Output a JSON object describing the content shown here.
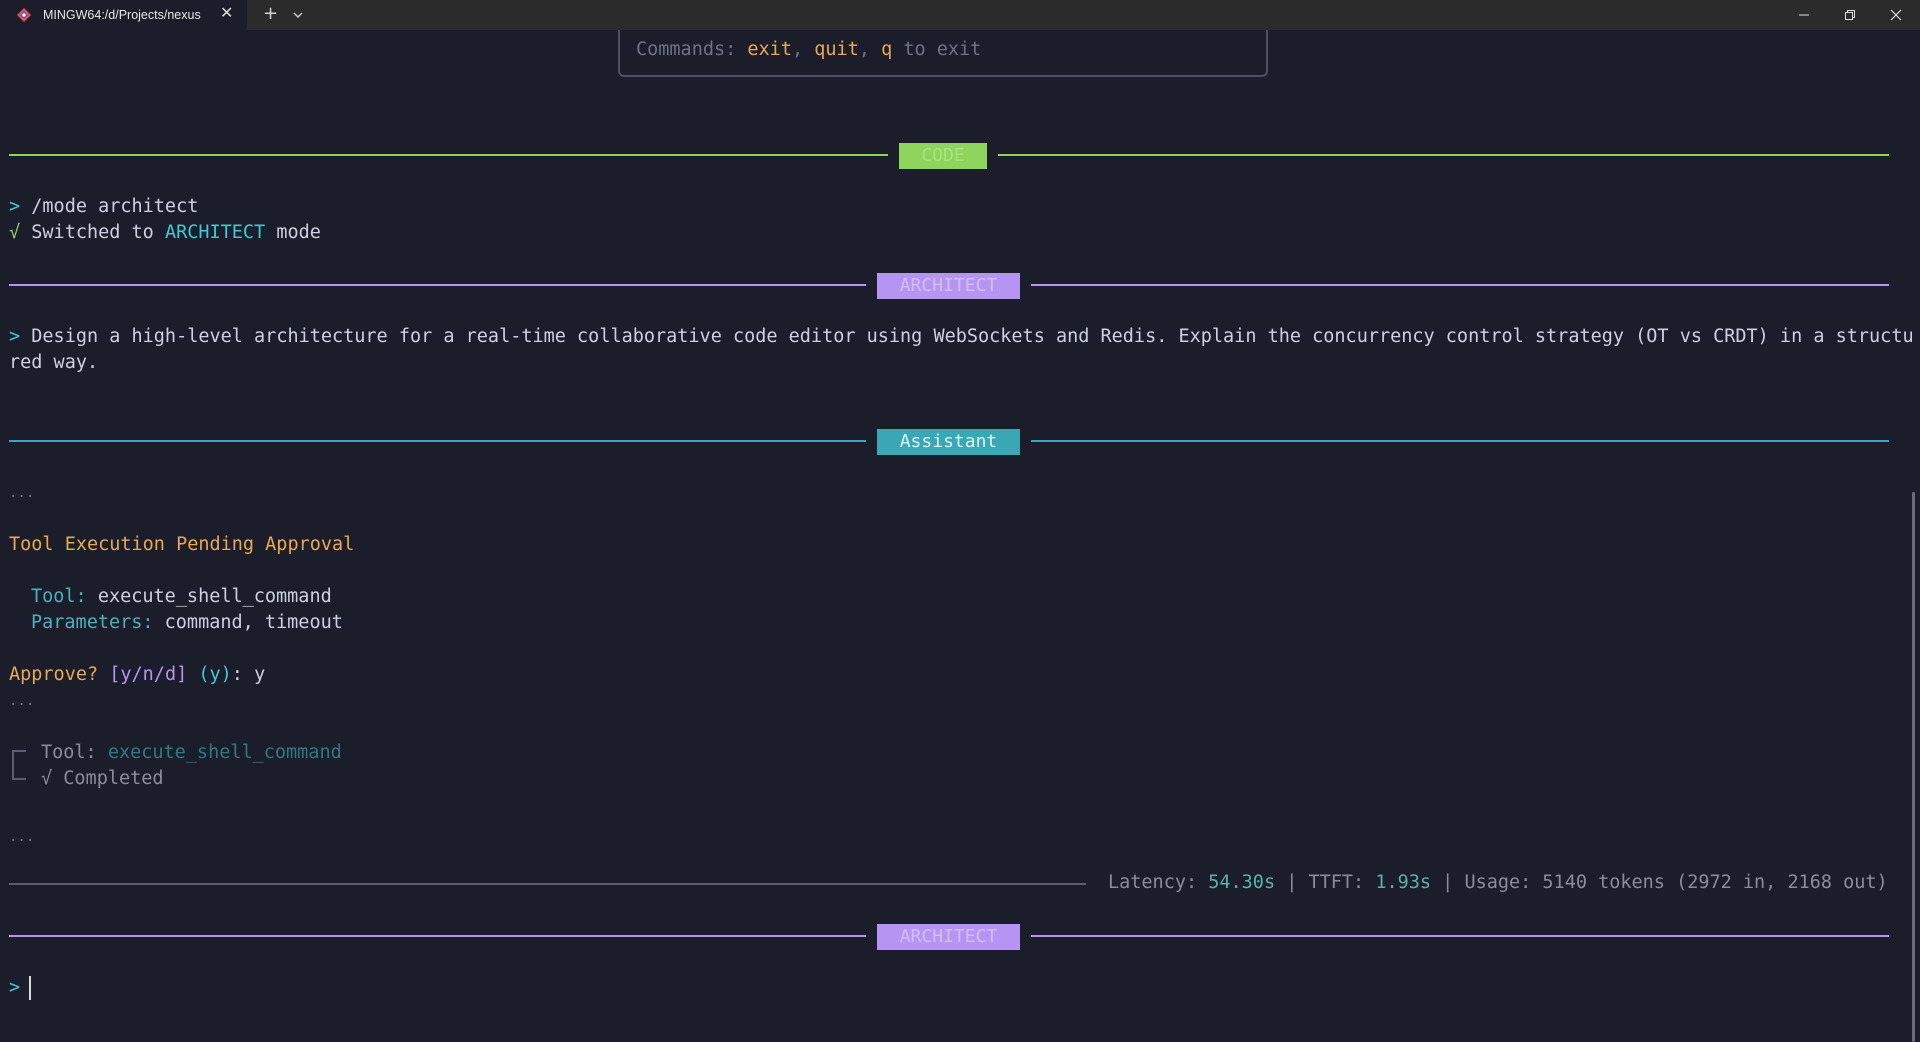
{
  "window": {
    "tab_title": "MINGW64:/d/Projects/nexus",
    "icons": {
      "app": "git-bash-icon",
      "close_tab": "close-icon",
      "new_tab": "plus-icon",
      "dropdown": "chevron-down-icon"
    }
  },
  "terminal": {
    "commands_box": {
      "prefix": "Commands: ",
      "cmd1": "exit",
      "sep1": ", ",
      "cmd2": "quit",
      "sep2": ", ",
      "cmd3": "q",
      "suffix": " to exit"
    },
    "code_badge": "CODE",
    "mode_cmd": {
      "prompt": ">",
      "text": " /mode architect"
    },
    "switched": {
      "check": "√",
      "pre": " Switched to ",
      "mode": "ARCHITECT",
      "post": " mode"
    },
    "architect_badge_1": "ARCHITECT",
    "user_prompt": {
      "prompt": ">",
      "line1": " Design a high-level architecture for a real-time collaborative code editor using WebSockets and Redis. Explain the concurrency control strategy (OT vs CRDT) in a structu",
      "line2": "red way."
    },
    "assistant_badge": "Assistant",
    "ellipsis": "...",
    "pending_title": "Tool Execution Pending Approval",
    "tool_label": "Tool: ",
    "tool_value": "execute_shell_command",
    "params_label": "Parameters: ",
    "params_value": "command, timeout",
    "approve": {
      "q": "Approve? ",
      "opts": "[y/n/d]",
      "sp": " ",
      "default": "(y)",
      "colon": ": ",
      "answer": "y"
    },
    "tool_done_label": "Tool: ",
    "tool_done_value": "execute_shell_command",
    "completed": "√ Completed",
    "stats": {
      "latency_label": "Latency: ",
      "latency": "54.30s",
      "sep": " | ",
      "ttft_label": "TTFT: ",
      "ttft": "1.93s",
      "usage_label": "Usage: ",
      "usage": "5140 tokens (2972 in, 2168 out)"
    },
    "architect_badge_2": "ARCHITECT",
    "input_prompt": ">"
  },
  "colors": {
    "background": "#1c1d2b",
    "code_green": "#8fd45c",
    "architect_purple": "#b695f2",
    "assistant_teal": "#3aa7b4",
    "orange": "#e8a954"
  }
}
